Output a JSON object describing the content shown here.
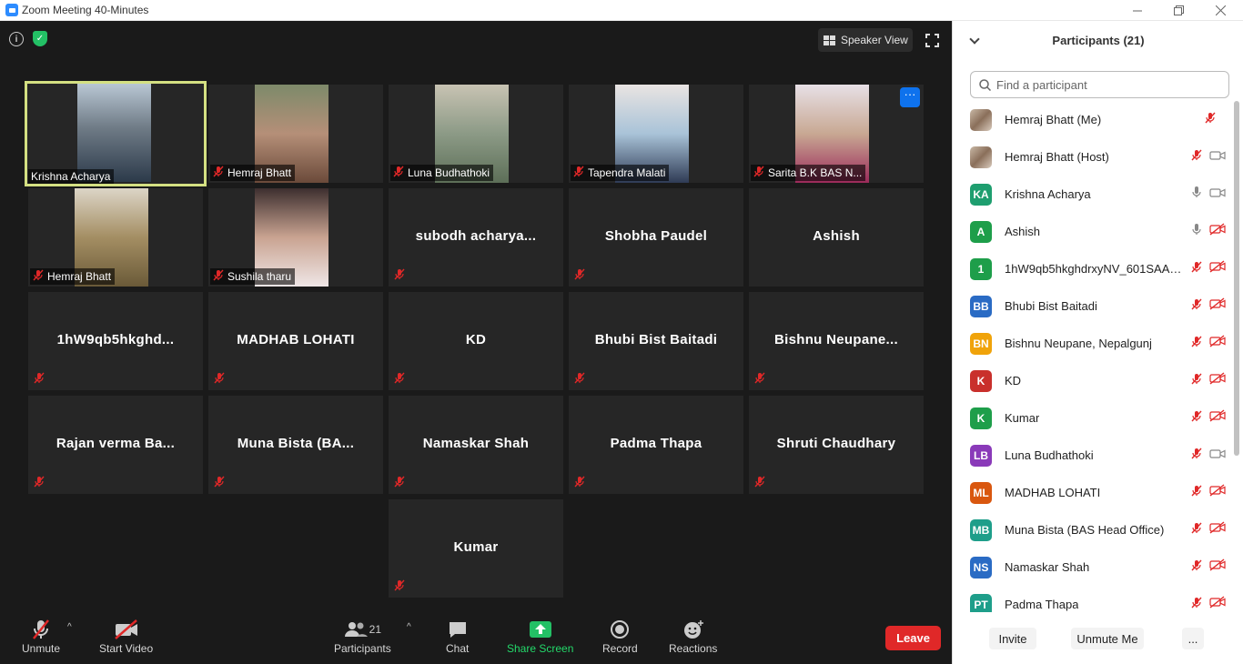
{
  "window": {
    "title": "Zoom Meeting 40-Minutes"
  },
  "top": {
    "speaker_view_label": "Speaker View",
    "more_label": "···"
  },
  "tiles": [
    {
      "name": "Krishna Acharya",
      "video": true,
      "muted": false,
      "active": true
    },
    {
      "name": "Hemraj Bhatt",
      "video": true,
      "muted": true
    },
    {
      "name": "Luna Budhathoki",
      "video": true,
      "muted": true
    },
    {
      "name": "Tapendra Malati",
      "video": true,
      "muted": true
    },
    {
      "name": "Sarita B.K BAS N...",
      "video": true,
      "muted": true
    },
    {
      "name": "Hemraj Bhatt",
      "video": true,
      "muted": true
    },
    {
      "name": "Sushila tharu",
      "video": true,
      "muted": true
    },
    {
      "name": "subodh  acharya...",
      "video": false,
      "muted": true
    },
    {
      "name": "Shobha Paudel",
      "video": false,
      "muted": true
    },
    {
      "name": "Ashish",
      "video": false,
      "muted": false
    },
    {
      "name": "1hW9qb5hkghd...",
      "video": false,
      "muted": true
    },
    {
      "name": "MADHAB LOHATI",
      "video": false,
      "muted": true
    },
    {
      "name": "KD",
      "video": false,
      "muted": true
    },
    {
      "name": "Bhubi Bist Baitadi",
      "video": false,
      "muted": true
    },
    {
      "name": "Bishnu  Neupane...",
      "video": false,
      "muted": true
    },
    {
      "name": "Rajan verma Ba...",
      "video": false,
      "muted": true
    },
    {
      "name": "Muna Bista (BA...",
      "video": false,
      "muted": true
    },
    {
      "name": "Namaskar Shah",
      "video": false,
      "muted": true
    },
    {
      "name": "Padma Thapa",
      "video": false,
      "muted": true
    },
    {
      "name": "Shruti Chaudhary",
      "video": false,
      "muted": true
    },
    {
      "name": "Kumar",
      "video": false,
      "muted": true
    }
  ],
  "toolbar": {
    "unmute": "Unmute",
    "start_video": "Start Video",
    "participants": "Participants",
    "participants_count": "21",
    "chat": "Chat",
    "share_screen": "Share Screen",
    "record": "Record",
    "reactions": "Reactions",
    "leave": "Leave"
  },
  "panel": {
    "title": "Participants (21)",
    "search_placeholder": "Find a participant",
    "participants": [
      {
        "name": "Hemraj Bhatt (Me)",
        "initials": "",
        "color": "",
        "mic": "muted-red",
        "cam": "none"
      },
      {
        "name": "Hemraj Bhatt (Host)",
        "initials": "",
        "color": "",
        "mic": "muted-red",
        "cam": "on"
      },
      {
        "name": "Krishna Acharya",
        "initials": "KA",
        "color": "#1e9e6f",
        "mic": "on",
        "cam": "on"
      },
      {
        "name": "Ashish",
        "initials": "A",
        "color": "#1e9e4a",
        "mic": "on",
        "cam": "off"
      },
      {
        "name": "1hW9qb5hkghdrxyNV_601SAAA...",
        "initials": "1",
        "color": "#1e9e4a",
        "mic": "muted-red",
        "cam": "off"
      },
      {
        "name": "Bhubi Bist Baitadi",
        "initials": "BB",
        "color": "#2a6bc4",
        "mic": "muted-red",
        "cam": "off"
      },
      {
        "name": "Bishnu Neupane, Nepalgunj",
        "initials": "BN",
        "color": "#f0a30a",
        "mic": "muted-red",
        "cam": "off"
      },
      {
        "name": "KD",
        "initials": "K",
        "color": "#c9302c",
        "mic": "muted-red",
        "cam": "off"
      },
      {
        "name": "Kumar",
        "initials": "K",
        "color": "#1e9e4a",
        "mic": "muted-red",
        "cam": "off"
      },
      {
        "name": "Luna Budhathoki",
        "initials": "LB",
        "color": "#8a3ab9",
        "mic": "muted-red",
        "cam": "on"
      },
      {
        "name": "MADHAB LOHATI",
        "initials": "ML",
        "color": "#d9570f",
        "mic": "muted-red",
        "cam": "off"
      },
      {
        "name": "Muna Bista (BAS Head Office)",
        "initials": "MB",
        "color": "#1e9e8a",
        "mic": "muted-red",
        "cam": "off"
      },
      {
        "name": "Namaskar Shah",
        "initials": "NS",
        "color": "#2a6bc4",
        "mic": "muted-red",
        "cam": "off"
      },
      {
        "name": "Padma Thapa",
        "initials": "PT",
        "color": "#1e9e8a",
        "mic": "muted-red",
        "cam": "off"
      }
    ],
    "invite": "Invite",
    "unmute_me": "Unmute Me",
    "more": "..."
  }
}
